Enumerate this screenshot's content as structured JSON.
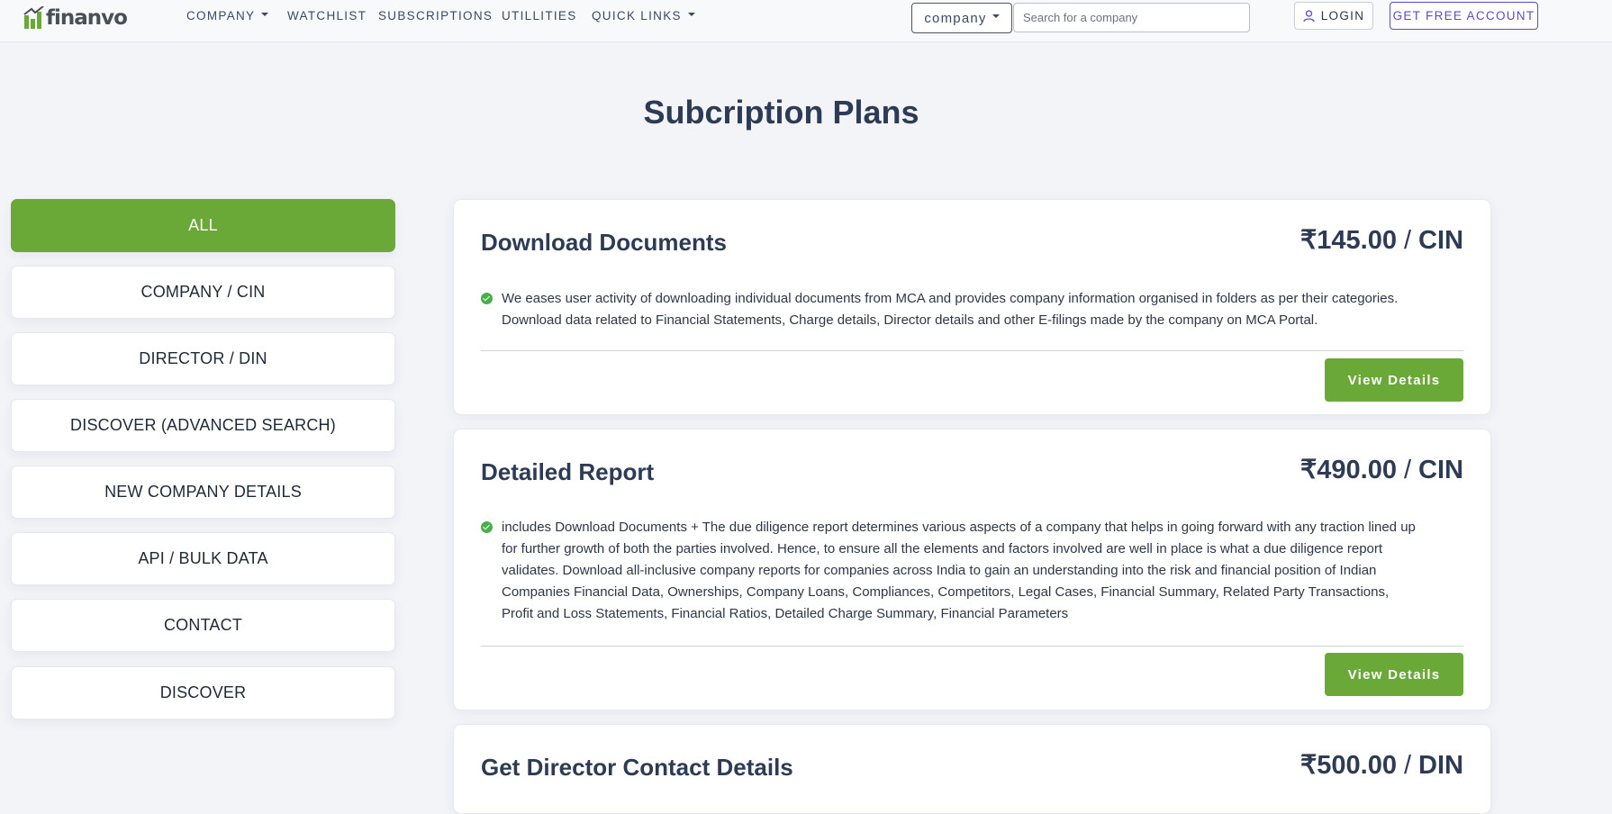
{
  "header": {
    "logo_text": "finanvo",
    "nav": [
      {
        "label": "COMPANY",
        "dropdown": true
      },
      {
        "label": "WATCHLIST",
        "dropdown": false
      },
      {
        "label": "SUBSCRIPTIONS",
        "dropdown": false
      },
      {
        "label": "UTILLITIES",
        "dropdown": false
      },
      {
        "label": "QUICK LINKS",
        "dropdown": true
      }
    ],
    "search": {
      "type_label": "company",
      "placeholder": "Search for a company",
      "value": ""
    },
    "login_label": "LOGIN",
    "signup_label": "GET FREE ACCOUNT"
  },
  "page_title": "Subcription Plans",
  "sidebar": {
    "active_index": 0,
    "items": [
      {
        "label": "ALL"
      },
      {
        "label": "COMPANY / CIN"
      },
      {
        "label": "DIRECTOR / DIN"
      },
      {
        "label": "DISCOVER (ADVANCED SEARCH)"
      },
      {
        "label": "NEW COMPANY DETAILS"
      },
      {
        "label": "API / BULK DATA"
      },
      {
        "label": "CONTACT"
      },
      {
        "label": "DISCOVER"
      }
    ]
  },
  "plans": [
    {
      "title": "Download Documents",
      "price": "₹145.00",
      "unit": "CIN",
      "feature": "We eases user activity of downloading individual documents from MCA and provides company information organised in folders as per their categories. Download data related to Financial Statements, Charge details, Director details and other E-filings made by the company on MCA Portal.",
      "button_label": "View Details"
    },
    {
      "title": "Detailed Report",
      "price": "₹490.00",
      "unit": "CIN",
      "feature": "includes Download Documents + The due diligence report determines various aspects of a company that helps in going forward with any traction lined up for further growth of both the parties involved. Hence, to ensure all the elements and factors involved are well in place is what a due diligence report validates. Download all-inclusive company reports for companies across India to gain an understanding into the risk and financial position of Indian Companies Financial Data, Ownerships, Company Loans, Compliances, Competitors, Legal Cases, Financial Summary, Related Party Transactions, Profit and Loss Statements, Financial Ratios, Detailed Charge Summary, Financial Parameters",
      "button_label": "View Details"
    },
    {
      "title": "Get Director Contact Details",
      "price": "₹500.00",
      "unit": "DIN"
    }
  ],
  "colors": {
    "accent_green": "#6aa837",
    "signup_purple": "#5a4bd1",
    "heading": "#2d3b55",
    "check_green": "#47b04b"
  }
}
